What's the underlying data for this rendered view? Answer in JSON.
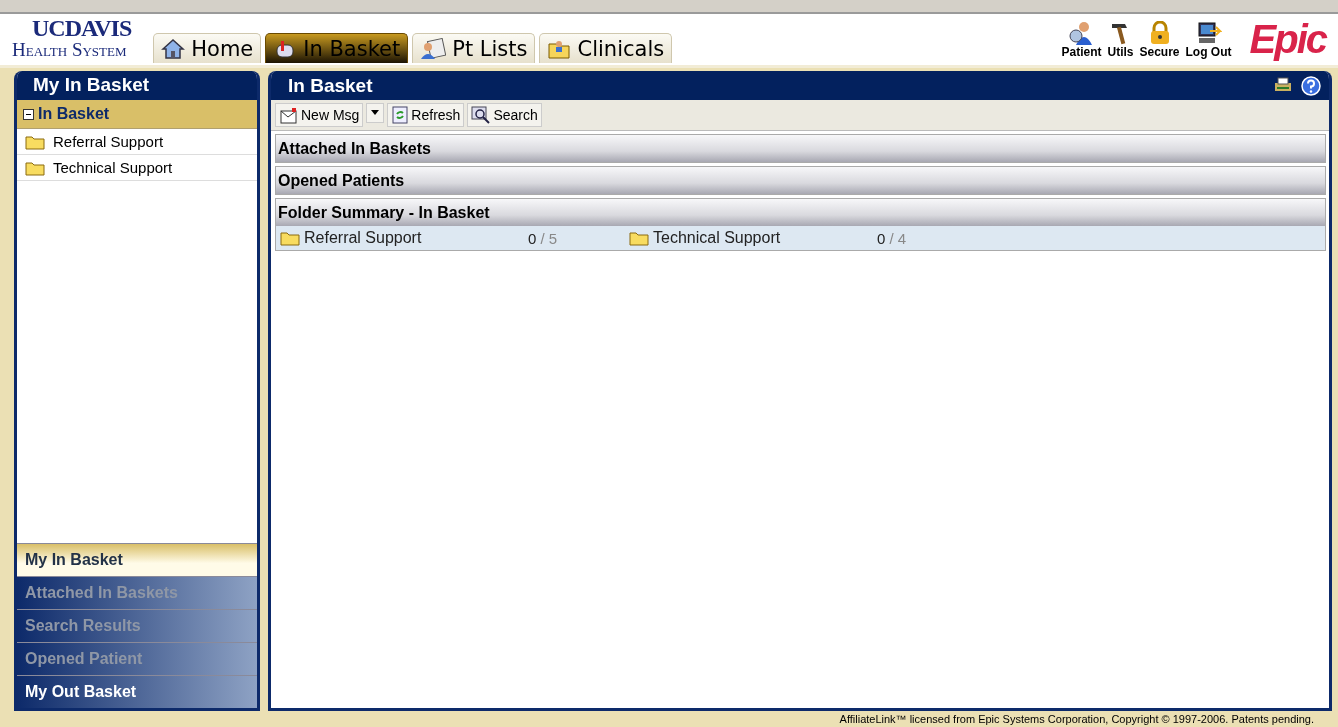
{
  "logo": {
    "line1_a": "UC",
    "line1_b": "DAVIS",
    "line2": "Health System"
  },
  "tabs": [
    {
      "label": "Home",
      "selected": false
    },
    {
      "label": "In Basket",
      "selected": true
    },
    {
      "label": "Pt Lists",
      "selected": false
    },
    {
      "label": "Clinicals",
      "selected": false
    }
  ],
  "tools": [
    {
      "label": "Patient"
    },
    {
      "label": "Utils"
    },
    {
      "label": "Secure"
    },
    {
      "label": "Log Out"
    }
  ],
  "brand": "Epic",
  "sidebar": {
    "title": "My In Basket",
    "tree": {
      "label": "In Basket",
      "expanded": true,
      "children": [
        {
          "label": "Referral Support"
        },
        {
          "label": "Technical Support"
        }
      ]
    },
    "nav": [
      {
        "label": "My In Basket",
        "selected": true,
        "disabled": false
      },
      {
        "label": "Attached In Baskets",
        "selected": false,
        "disabled": true
      },
      {
        "label": "Search Results",
        "selected": false,
        "disabled": true
      },
      {
        "label": "Opened Patient",
        "selected": false,
        "disabled": true
      },
      {
        "label": "My Out Basket",
        "selected": false,
        "disabled": false
      }
    ]
  },
  "main": {
    "title": "In Basket",
    "toolbar": [
      {
        "label": "New Msg"
      },
      {
        "label": "Refresh"
      },
      {
        "label": "Search"
      }
    ],
    "sections": [
      {
        "title": "Attached In Baskets"
      },
      {
        "title": "Opened Patients"
      },
      {
        "title": "Folder Summary - In Basket",
        "folders": [
          {
            "name": "Referral Support",
            "unread": "0",
            "separator": "/",
            "total": "5"
          },
          {
            "name": "Technical Support",
            "unread": "0",
            "separator": "/",
            "total": "4"
          }
        ]
      }
    ]
  },
  "footer": "AffiliateLink™ licensed from Epic Systems Corporation, Copyright © 1997-2006. Patents pending."
}
